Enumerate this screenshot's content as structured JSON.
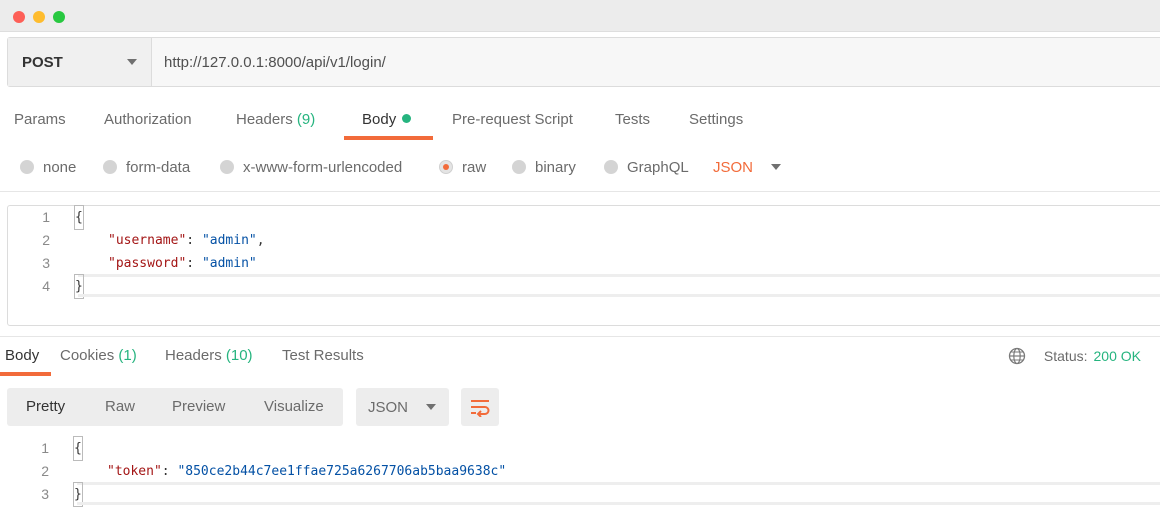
{
  "window": {
    "controls": {
      "close_color": "#fd5f57",
      "minimize_color": "#febc2e",
      "maximize_color": "#28c840"
    }
  },
  "request": {
    "method": "POST",
    "url": "http://127.0.0.1:8000/api/v1/login/",
    "tabs": [
      {
        "label": "Params",
        "count": ""
      },
      {
        "label": "Authorization",
        "count": ""
      },
      {
        "label": "Headers",
        "count": "(9)"
      },
      {
        "label": "Body",
        "count": ""
      },
      {
        "label": "Pre-request Script",
        "count": ""
      },
      {
        "label": "Tests",
        "count": ""
      },
      {
        "label": "Settings",
        "count": ""
      }
    ],
    "active_tab": "Body",
    "body_types": [
      "none",
      "form-data",
      "x-www-form-urlencoded",
      "raw",
      "binary",
      "GraphQL"
    ],
    "selected_body_type": "raw",
    "language": "JSON",
    "body_lines": [
      {
        "num": "1",
        "open": "{"
      },
      {
        "num": "2",
        "key": "\"username\"",
        "sep": ": ",
        "value": "\"admin\"",
        "tail": ","
      },
      {
        "num": "3",
        "key": "\"password\"",
        "sep": ": ",
        "value": "\"admin\"",
        "tail": ""
      },
      {
        "num": "4",
        "close": "}"
      }
    ]
  },
  "response": {
    "tabs": [
      {
        "label": "Body",
        "count": ""
      },
      {
        "label": "Cookies",
        "count": "(1)"
      },
      {
        "label": "Headers",
        "count": "(10)"
      },
      {
        "label": "Test Results",
        "count": ""
      }
    ],
    "active_tab": "Body",
    "status_label": "Status:",
    "status_value": "200 OK",
    "views": [
      "Pretty",
      "Raw",
      "Preview",
      "Visualize"
    ],
    "active_view": "Pretty",
    "format": "JSON",
    "wrap_icon": "wrap-lines-icon",
    "body_lines": [
      {
        "num": "1",
        "open": "{"
      },
      {
        "num": "2",
        "key": "\"token\"",
        "sep": ": ",
        "value": "\"850ce2b44c7ee1ffae725a6267706ab5baa9638c\"",
        "tail": ""
      },
      {
        "num": "3",
        "close": "}"
      }
    ]
  },
  "colors": {
    "accent": "#f26b3a",
    "success": "#26b47f",
    "json_key": "#a31515",
    "json_value": "#0451a5"
  }
}
